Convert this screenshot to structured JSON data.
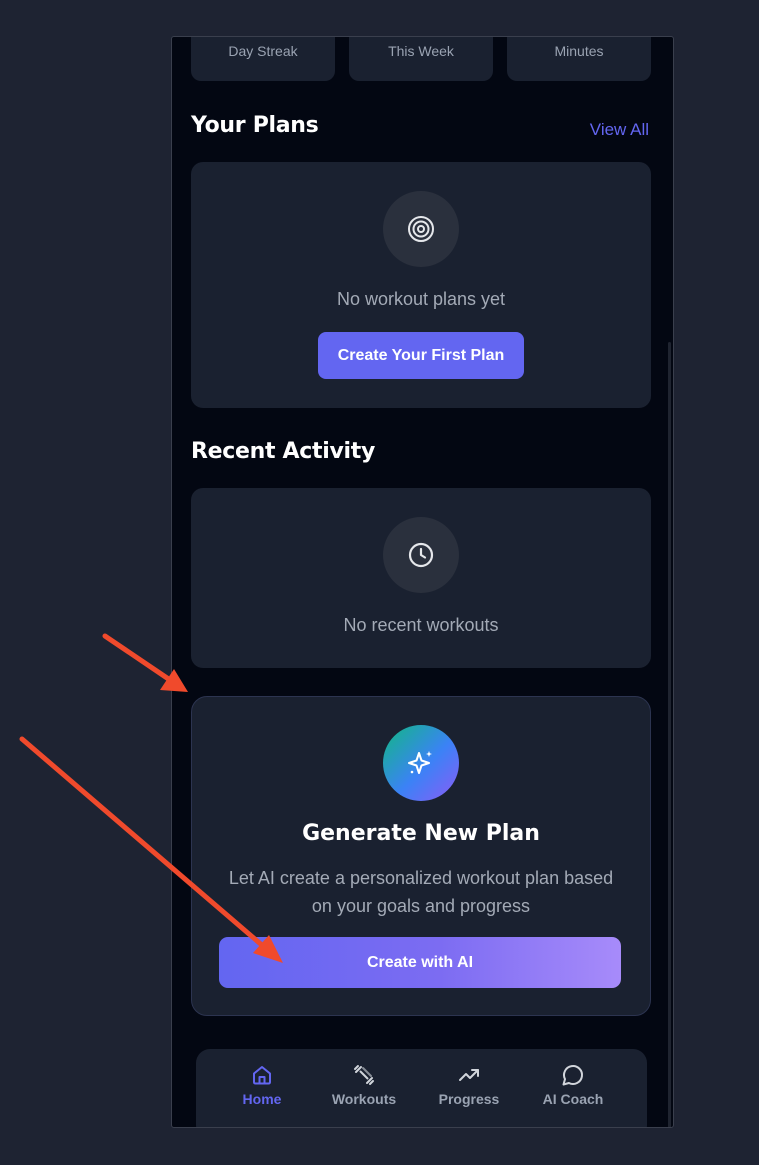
{
  "stats": {
    "items": [
      {
        "label": "Day Streak"
      },
      {
        "label": "This Week"
      },
      {
        "label": "Minutes"
      }
    ]
  },
  "plans": {
    "title": "Your Plans",
    "view_all": "View All",
    "empty_text": "No workout plans yet",
    "icon": "target-icon",
    "create_button": "Create Your First Plan"
  },
  "activity": {
    "title": "Recent Activity",
    "empty_text": "No recent workouts",
    "icon": "clock-icon"
  },
  "generate": {
    "title": "Generate New Plan",
    "description": "Let AI create a personalized workout plan based on your goals and progress",
    "button": "Create with AI",
    "icon": "sparkles-icon"
  },
  "nav": {
    "items": [
      {
        "label": "Home",
        "icon": "home-icon",
        "active": true
      },
      {
        "label": "Workouts",
        "icon": "dumbbell-icon",
        "active": false
      },
      {
        "label": "Progress",
        "icon": "trending-up-icon",
        "active": false
      },
      {
        "label": "AI Coach",
        "icon": "chat-bubble-icon",
        "active": false
      }
    ]
  },
  "colors": {
    "page_bg": "#1e2332",
    "app_bg": "#030712",
    "card_bg": "#1a2130",
    "accent": "#6366f1",
    "annotation_arrow": "#f04a2c"
  }
}
